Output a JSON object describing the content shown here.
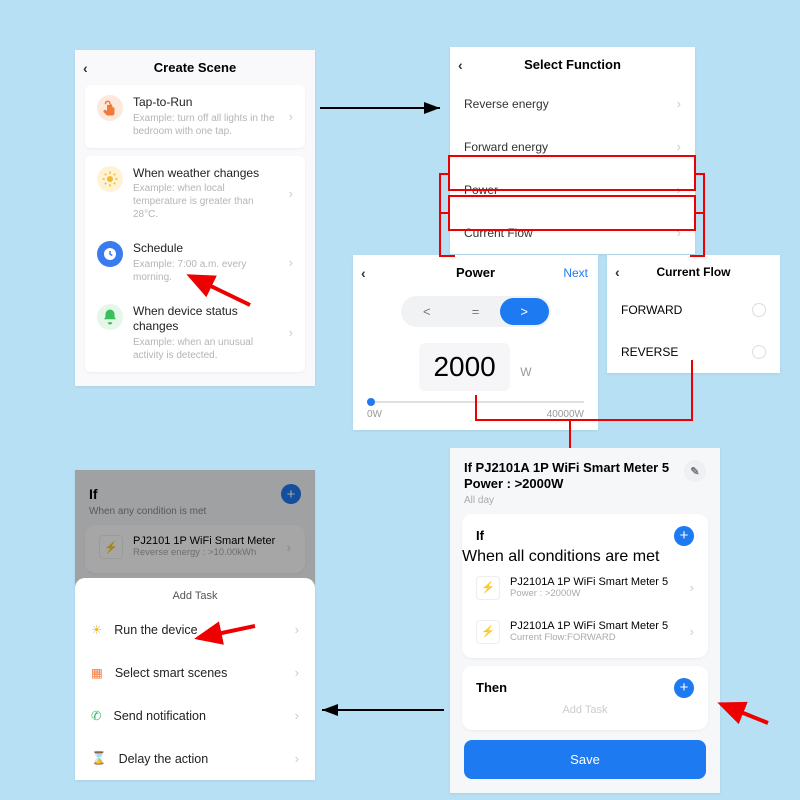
{
  "createScene": {
    "title": "Create Scene",
    "items": [
      {
        "title": "Tap-to-Run",
        "subtitle": "Example: turn off all lights in the bedroom with one tap."
      },
      {
        "title": "When weather changes",
        "subtitle": "Example: when local temperature is greater than 28°C."
      },
      {
        "title": "Schedule",
        "subtitle": "Example: 7:00 a.m. every morning."
      },
      {
        "title": "When device status changes",
        "subtitle": "Example: when an unusual activity is detected."
      }
    ]
  },
  "selectFunction": {
    "title": "Select Function",
    "items": [
      "Reverse energy",
      "Forward energy",
      "Power",
      "Current Flow"
    ]
  },
  "power": {
    "title": "Power",
    "next": "Next",
    "ops": {
      "lt": "<",
      "eq": "=",
      "gt": ">"
    },
    "value": "2000",
    "unit": "W",
    "min": "0W",
    "max": "40000W"
  },
  "currentFlow": {
    "title": "Current Flow",
    "options": [
      "FORWARD",
      "REVERSE"
    ]
  },
  "summary": {
    "headline": "If PJ2101A 1P WiFi Smart Meter  5 Power : >2000W",
    "allday": "All day",
    "ifLabel": "If",
    "ifSub": "When all conditions are met",
    "conds": [
      {
        "name": "PJ2101A 1P WiFi Smart Meter 5",
        "detail": "Power : >2000W"
      },
      {
        "name": "PJ2101A 1P WiFi Smart Meter 5",
        "detail": "Current Flow:FORWARD"
      }
    ],
    "thenLabel": "Then",
    "addTask": "Add Task",
    "save": "Save"
  },
  "taskScreen": {
    "ifLabel": "If",
    "ifSub": "When any condition is met",
    "device": "PJ2101 1P WiFi Smart Meter",
    "deviceSub": "Reverse energy : >10.00kWh",
    "sheetTitle": "Add Task",
    "options": [
      "Run the device",
      "Select smart scenes",
      "Send notification",
      "Delay the action"
    ]
  }
}
